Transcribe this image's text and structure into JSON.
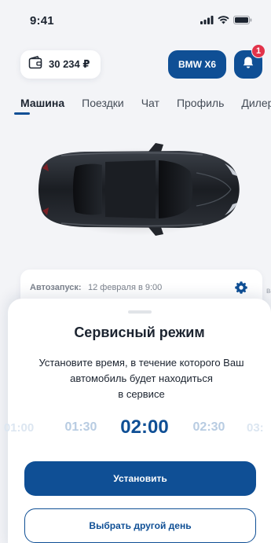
{
  "status_bar": {
    "time": "9:41"
  },
  "header": {
    "balance": "30 234 ₽",
    "car_model": "BMW X6",
    "notifications_count": "1"
  },
  "tabs": [
    {
      "label": "Машина",
      "active": true
    },
    {
      "label": "Поездки",
      "active": false
    },
    {
      "label": "Чат",
      "active": false
    },
    {
      "label": "Профиль",
      "active": false
    },
    {
      "label": "Дилер",
      "active": false
    }
  ],
  "autostart": {
    "label": "Автозапуск:",
    "value": "12 февраля в 9:00",
    "peek_text": "ва"
  },
  "sheet": {
    "title": "Сервисный режим",
    "description_lines": [
      "Установите время, в течение которого Ваш",
      "автомобиль будет находиться",
      "в сервисе"
    ],
    "time_options": [
      "01:00",
      "01:30",
      "02:00",
      "02:30",
      "03:"
    ],
    "selected_time": "02:00",
    "primary_button": "Установить",
    "secondary_button": "Выбрать другой день"
  },
  "colors": {
    "accent": "#0f4f95",
    "badge": "#e2334a",
    "background": "#f3f4f7"
  },
  "icons": [
    "wallet-icon",
    "bell-icon",
    "gear-icon",
    "signal-icon",
    "wifi-icon",
    "battery-icon"
  ]
}
